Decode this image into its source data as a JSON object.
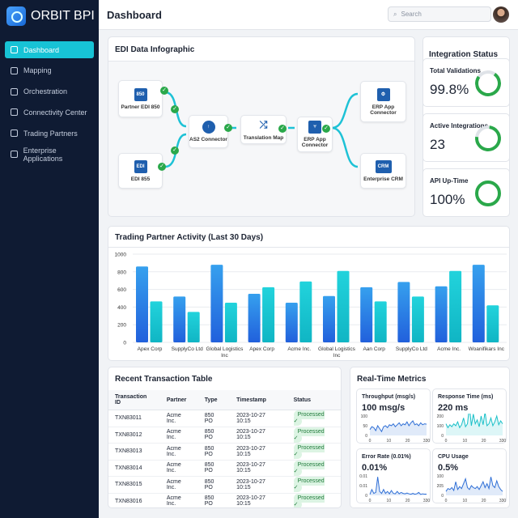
{
  "app": {
    "brand": "ORBIT BPI"
  },
  "sidebar": {
    "items": [
      {
        "label": "Dashboard",
        "active": true,
        "icon": "dashboard-icon"
      },
      {
        "label": "Mapping",
        "icon": "mapping-icon"
      },
      {
        "label": "Orchestration",
        "icon": "sliders-icon"
      },
      {
        "label": "Connectivity Center",
        "icon": "link-icon"
      },
      {
        "label": "Trading Partners",
        "icon": "users-icon"
      },
      {
        "label": "Enterprise Applications",
        "icon": "apps-icon"
      }
    ]
  },
  "header": {
    "title": "Dashboard",
    "search_placeholder": "Search"
  },
  "infographic": {
    "title": "EDI Data Infographic",
    "nodes": {
      "p850": {
        "label": "Partner EDI 850",
        "icon": "850"
      },
      "e855": {
        "label": "EDI 855",
        "icon": "EDI"
      },
      "as2": {
        "label": "AS2 Connector"
      },
      "tmap": {
        "label": "Translation Map"
      },
      "erp1": {
        "label": "ERP App Connector"
      },
      "erp2": {
        "label": "ERP App Connector"
      },
      "crm": {
        "label": "Enterprise CRM",
        "icon": "CRM"
      }
    }
  },
  "status": {
    "title": "Integration Status",
    "cards": [
      {
        "label": "Total Validations",
        "value": "99.8%",
        "fill": 0.998
      },
      {
        "label": "Active Integrations",
        "value": "23",
        "fill": 0.92
      },
      {
        "label": "API Up-Time",
        "value": "100%",
        "fill": 1
      }
    ]
  },
  "chart_data": {
    "type": "bar",
    "title": "Trading Partner Activity (Last 30 Days)",
    "categories": [
      "Apex Corp",
      "SupplyCo Ltd",
      "Global Logistics Inc",
      "Apex Corp",
      "Acme Inc.",
      "Global Logistics Inc",
      "Aan Corp",
      "SupplyCo Ltd",
      "Acme Inc.",
      "Woanifikars Inc"
    ],
    "series": [
      {
        "values": [
          860,
          520,
          880,
          550,
          450,
          525,
          625,
          685,
          635,
          880
        ],
        "color": "#2f7fe6"
      },
      {
        "values": [
          465,
          345,
          450,
          625,
          690,
          810,
          465,
          520,
          810,
          420
        ],
        "color": "#19c7d4"
      }
    ],
    "ylim": [
      0,
      1000
    ],
    "yticks": [
      0,
      200,
      400,
      600,
      800,
      1000
    ],
    "grid": true
  },
  "table": {
    "title": "Recent Transaction Table",
    "columns": [
      "Transaction ID",
      "Partner",
      "Type",
      "Timestamp",
      "Status"
    ],
    "rows": [
      [
        "TXN83011",
        "Acme Inc.",
        "850 PO",
        "2023-10-27 10:15",
        "Processed ✓"
      ],
      [
        "TXN83012",
        "Acme Inc.",
        "850 PO",
        "2023-10-27 10:15",
        "Processed ✓"
      ],
      [
        "TXN83013",
        "Acme Inc.",
        "850 PO",
        "2023-10-27 10:15",
        "Processed ✓"
      ],
      [
        "TXN83014",
        "Acme Inc.",
        "850 PO",
        "2023-10-27 10:15",
        "Processed ✓"
      ],
      [
        "TXN83015",
        "Acme Inc.",
        "850 PO",
        "2023-10-27 10:15",
        "Processed ✓"
      ],
      [
        "TXN83016",
        "Acme Inc.",
        "850 PO",
        "2023-10-27 10:15",
        "Processed ✓"
      ]
    ]
  },
  "metrics": {
    "title": "Real-Time Metrics",
    "cards": [
      {
        "label": "Throughput (msg/s)",
        "value": "100 msg/s",
        "yticks": [
          "100",
          "50",
          "0"
        ],
        "xticks": [
          "0",
          "10",
          "20",
          "330"
        ],
        "color": "#2f6fd6",
        "data": [
          30,
          45,
          40,
          25,
          50,
          35,
          20,
          45,
          50,
          40,
          55,
          50,
          60,
          45,
          55,
          65,
          50,
          60,
          55,
          70,
          50,
          65,
          75,
          55,
          60,
          50,
          65,
          55,
          60,
          58
        ]
      },
      {
        "label": "Response Time (ms)",
        "value": "220 ms",
        "yticks": [
          "200",
          "100",
          "0"
        ],
        "xticks": [
          "0",
          "10",
          "20",
          "330"
        ],
        "color": "#19c0c8",
        "data": [
          60,
          40,
          55,
          45,
          60,
          50,
          70,
          40,
          55,
          90,
          45,
          60,
          150,
          50,
          110,
          60,
          80,
          45,
          100,
          55,
          120,
          50,
          60,
          90,
          50,
          70,
          100,
          55,
          75,
          60
        ]
      },
      {
        "label": "Error Rate (0.01%)",
        "value": "0.01%",
        "yticks": [
          "0.01",
          "0.01",
          "0"
        ],
        "xticks": [
          "0",
          "10",
          "20",
          "330"
        ],
        "color": "#2f6fd6",
        "data": [
          5,
          30,
          10,
          15,
          95,
          20,
          10,
          30,
          10,
          20,
          8,
          25,
          10,
          8,
          20,
          8,
          15,
          10,
          8,
          12,
          8,
          6,
          10,
          6,
          8,
          15,
          5,
          8,
          6,
          6
        ]
      },
      {
        "label": "CPU Usage",
        "value": "0.5%",
        "yticks": [
          "100",
          "205",
          "0"
        ],
        "xticks": [
          "0",
          "10",
          "20",
          "330"
        ],
        "color": "#2f6fd6",
        "data": [
          20,
          35,
          30,
          40,
          25,
          70,
          30,
          45,
          35,
          60,
          85,
          40,
          30,
          50,
          40,
          35,
          45,
          30,
          50,
          70,
          40,
          60,
          35,
          95,
          50,
          40,
          75,
          45,
          30,
          20
        ]
      }
    ]
  }
}
